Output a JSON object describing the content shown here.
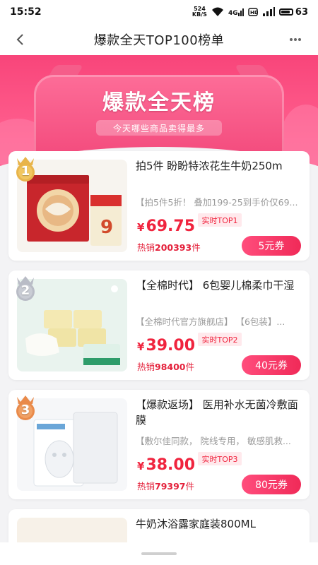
{
  "status_bar": {
    "time": "15:52",
    "net_speed_value": "524",
    "net_speed_unit": "KB/S",
    "battery": "63"
  },
  "nav": {
    "title": "爆款全天TOP100榜单"
  },
  "banner": {
    "title": "爆款全天榜",
    "subtitle": "今天哪些商品卖得最多"
  },
  "products": [
    {
      "rank_number": "1",
      "name": "拍5件 盼盼特浓花生牛奶250m",
      "desc": "【拍5件5折！ 叠加199-25到手价仅69...",
      "currency": "¥",
      "price": "69.75",
      "rank_label": "实时TOP1",
      "sold_prefix": "热销",
      "sold_count": "200393",
      "sold_suffix": "件",
      "coupon": "5元券"
    },
    {
      "rank_number": "2",
      "name": "【全棉时代】 6包婴儿棉柔巾干湿",
      "desc": "【全棉时代官方旗舰店】 【6包装】...",
      "currency": "¥",
      "price": "39.00",
      "rank_label": "实时TOP2",
      "sold_prefix": "热销",
      "sold_count": "98400",
      "sold_suffix": "件",
      "coupon": "40元券"
    },
    {
      "rank_number": "3",
      "name": "【爆款返场】 医用补水无菌冷敷面膜",
      "desc": "【敷尔佳同款， 院线专用， 敏感肌救...",
      "currency": "¥",
      "price": "38.00",
      "rank_label": "实时TOP3",
      "sold_prefix": "热销",
      "sold_count": "79397",
      "sold_suffix": "件",
      "coupon": "80元券"
    },
    {
      "name": "牛奶沐浴露家庭装800ML"
    }
  ],
  "colors": {
    "accent": "#f0243e",
    "banner": "#f8457a",
    "gold_badge": "#e8b44a",
    "silver_badge": "#b9bcc6",
    "bronze_badge": "#e98a4a"
  }
}
